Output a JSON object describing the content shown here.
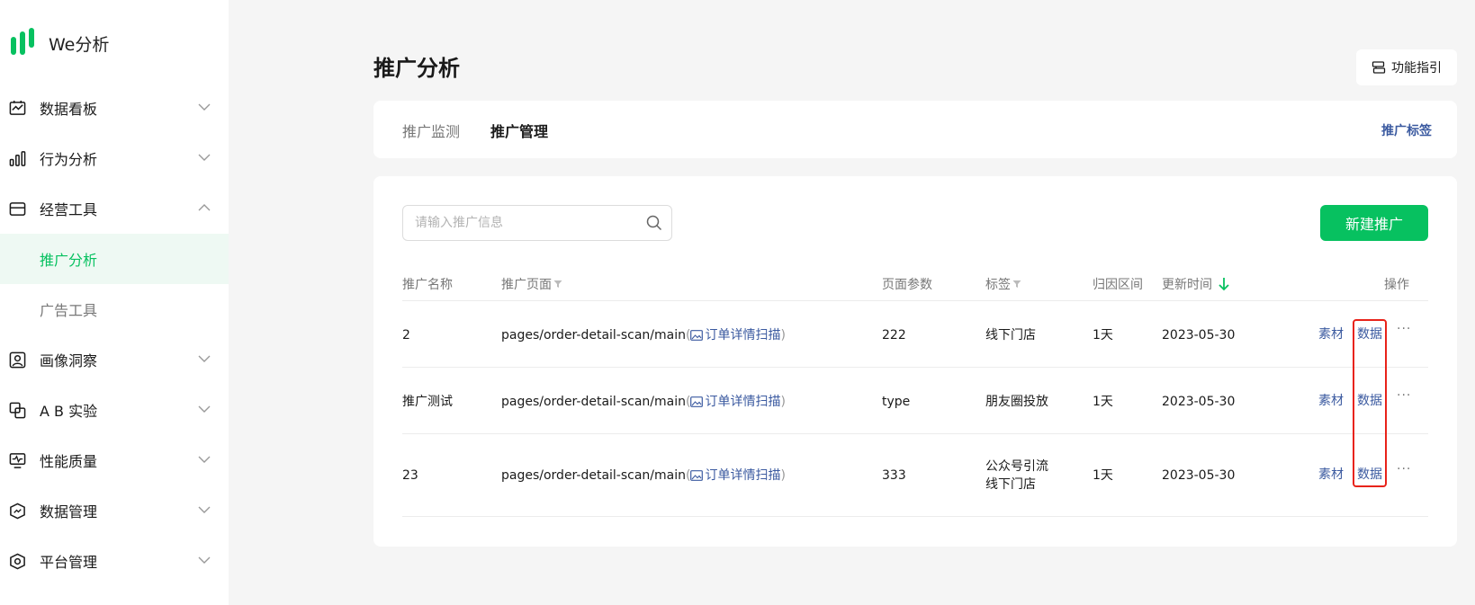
{
  "app": {
    "logo_text": "We分析"
  },
  "sidebar": {
    "items": [
      {
        "label": "数据看板",
        "icon": "dashboard-icon",
        "expanded": false
      },
      {
        "label": "行为分析",
        "icon": "bar-chart-icon",
        "expanded": false
      },
      {
        "label": "经营工具",
        "icon": "store-icon",
        "expanded": true,
        "children": [
          {
            "label": "推广分析",
            "active": true
          },
          {
            "label": "广告工具",
            "active": false
          }
        ]
      },
      {
        "label": "画像洞察",
        "icon": "portrait-icon",
        "expanded": false
      },
      {
        "label": "A B 实验",
        "icon": "ab-test-icon",
        "expanded": false
      },
      {
        "label": "性能质量",
        "icon": "monitor-icon",
        "expanded": false
      },
      {
        "label": "数据管理",
        "icon": "data-shield-icon",
        "expanded": false
      },
      {
        "label": "平台管理",
        "icon": "settings-hex-icon",
        "expanded": false
      }
    ]
  },
  "page": {
    "title": "推广分析",
    "guide_label": "功能指引"
  },
  "tabs": {
    "items": [
      {
        "label": "推广监测",
        "active": false
      },
      {
        "label": "推广管理",
        "active": true
      }
    ],
    "right_link": "推广标签"
  },
  "toolbar": {
    "search_placeholder": "请输入推广信息",
    "create_label": "新建推广"
  },
  "table": {
    "columns": {
      "name": "推广名称",
      "page": "推广页面",
      "params": "页面参数",
      "tags": "标签",
      "attribution": "归因区间",
      "updated": "更新时间",
      "actions": "操作"
    },
    "action_labels": {
      "material": "素材",
      "data": "数据",
      "more": "···"
    },
    "rows": [
      {
        "name": "2",
        "page_path": "pages/order-detail-scan/main",
        "page_name": "订单详情扫描",
        "params": "222",
        "tags": [
          "线下门店"
        ],
        "attribution": "1天",
        "updated": "2023-05-30"
      },
      {
        "name": "推广测试",
        "page_path": "pages/order-detail-scan/main",
        "page_name": "订单详情扫描",
        "params": "type",
        "tags": [
          "朋友圈投放"
        ],
        "attribution": "1天",
        "updated": "2023-05-30"
      },
      {
        "name": "23",
        "page_path": "pages/order-detail-scan/main",
        "page_name": "订单详情扫描",
        "params": "333",
        "tags": [
          "公众号引流",
          "线下门店"
        ],
        "attribution": "1天",
        "updated": "2023-05-30"
      }
    ]
  },
  "colors": {
    "brand": "#07c160",
    "link": "#3b5aa0",
    "highlight": "#e8231a"
  }
}
